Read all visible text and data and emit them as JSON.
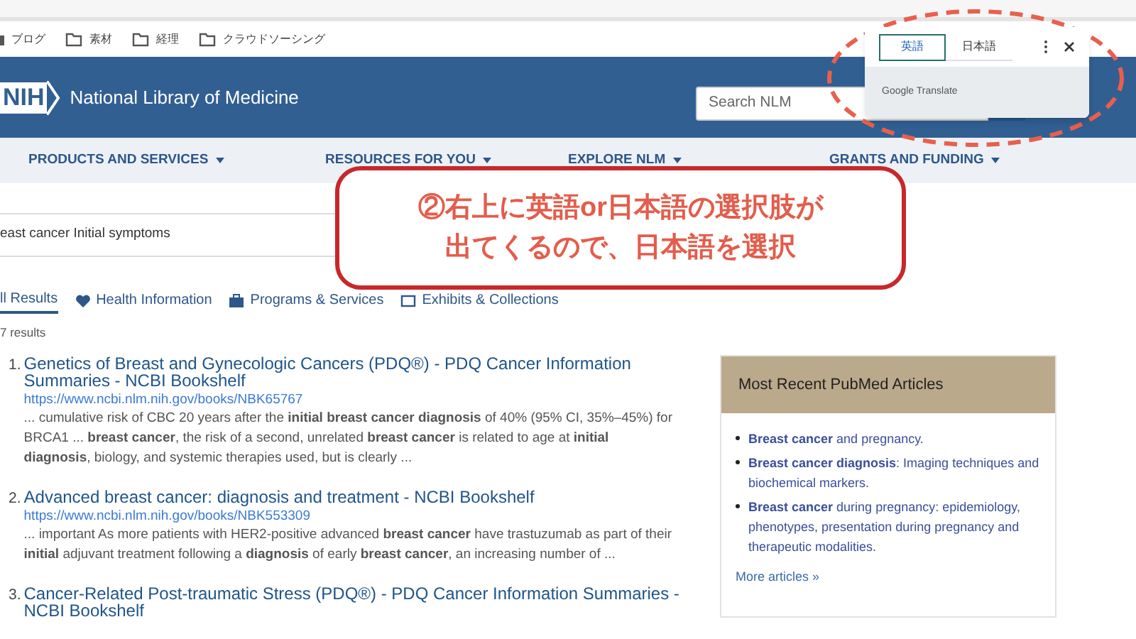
{
  "bookmarks": [
    {
      "label": "ブログ"
    },
    {
      "label": "素材"
    },
    {
      "label": "経理"
    },
    {
      "label": "クラウドソーシング"
    }
  ],
  "header": {
    "logo": "NIH",
    "title": "National Library of Medicine",
    "search": {
      "placeholder": "Search NLM"
    }
  },
  "nav": [
    {
      "label": "PRODUCTS AND SERVICES"
    },
    {
      "label": "RESOURCES FOR YOU"
    },
    {
      "label": "EXPLORE NLM"
    },
    {
      "label": "GRANTS AND FUNDING"
    }
  ],
  "query": "east cancer Initial symptoms",
  "tabs": [
    {
      "label": "ll Results",
      "selected": true
    },
    {
      "label": "Health Information",
      "selected": false
    },
    {
      "label": "Programs & Services",
      "selected": false
    },
    {
      "label": "Exhibits & Collections",
      "selected": false
    }
  ],
  "result_count": "7 results",
  "results": [
    {
      "number": "1.",
      "title": "Genetics of Breast and Gynecologic Cancers (PDQ®) - PDQ Cancer Information Summaries - NCBI Bookshelf",
      "url": "https://www.ncbi.nlm.nih.gov/books/NBK65767",
      "snippet": "... cumulative risk of CBC 20 years after the **initial breast cancer diagnosis** of 40% (95% CI, 35%–45%) for BRCA1 ... **breast cancer**, the risk of a second, unrelated **breast cancer** is related to age at **initial diagnosis**, biology, and systemic therapies used, but is clearly ..."
    },
    {
      "number": "2.",
      "title": "Advanced breast cancer: diagnosis and treatment - NCBI Bookshelf",
      "url": "https://www.ncbi.nlm.nih.gov/books/NBK553309",
      "snippet": "... important As more patients with HER2-positive advanced **breast cancer** have trastuzumab as part of their **initial** adjuvant treatment following a **diagnosis** of early **breast cancer**, an increasing number of ..."
    },
    {
      "number": "3.",
      "title": "Cancer-Related Post-traumatic Stress (PDQ®) - PDQ Cancer Information Summaries - NCBI Bookshelf"
    }
  ],
  "sidebar": {
    "title": "Most Recent PubMed Articles",
    "articles": [
      "**Breast cancer** and pregnancy.",
      "**Breast cancer diagnosis**: Imaging techniques and biochemical markers.",
      "**Breast cancer** during pregnancy: epidemiology, phenotypes, presentation during pregnancy and therapeutic modalities."
    ],
    "more": "More articles »"
  },
  "translate_popup": {
    "languages": [
      {
        "label": "英語",
        "selected": true
      },
      {
        "label": "日本語",
        "selected": false
      }
    ],
    "footer": "Google Translate"
  },
  "callout": {
    "lines": [
      "②右上に英語or日本語の選択肢が",
      "出てくるので、日本語を選択"
    ]
  }
}
